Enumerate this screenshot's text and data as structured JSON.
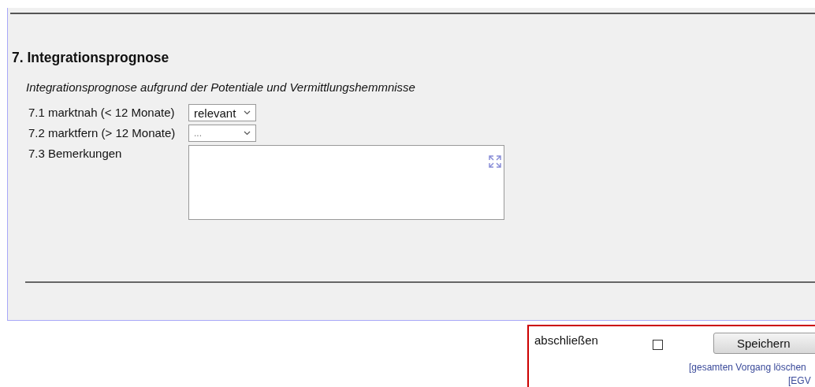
{
  "section": {
    "heading": "7. Integrationsprognose",
    "subtitle": "Integrationsprognose aufgrund der Potentiale und Vermittlungshemmnisse",
    "fields": [
      {
        "kind": "select",
        "label": "7.1 marktnah (< 12 Monate)",
        "value": "relevant"
      },
      {
        "kind": "select",
        "label": "7.2 marktfern (> 12 Monate)",
        "placeholder": "..."
      },
      {
        "kind": "textarea",
        "label": "7.3 Bemerkungen"
      }
    ]
  },
  "footer": {
    "close_label": "abschließen",
    "close_checked": false,
    "save_button": "Speichern",
    "links": [
      "[gesamten Vorgang löschen",
      "[EGV"
    ]
  }
}
